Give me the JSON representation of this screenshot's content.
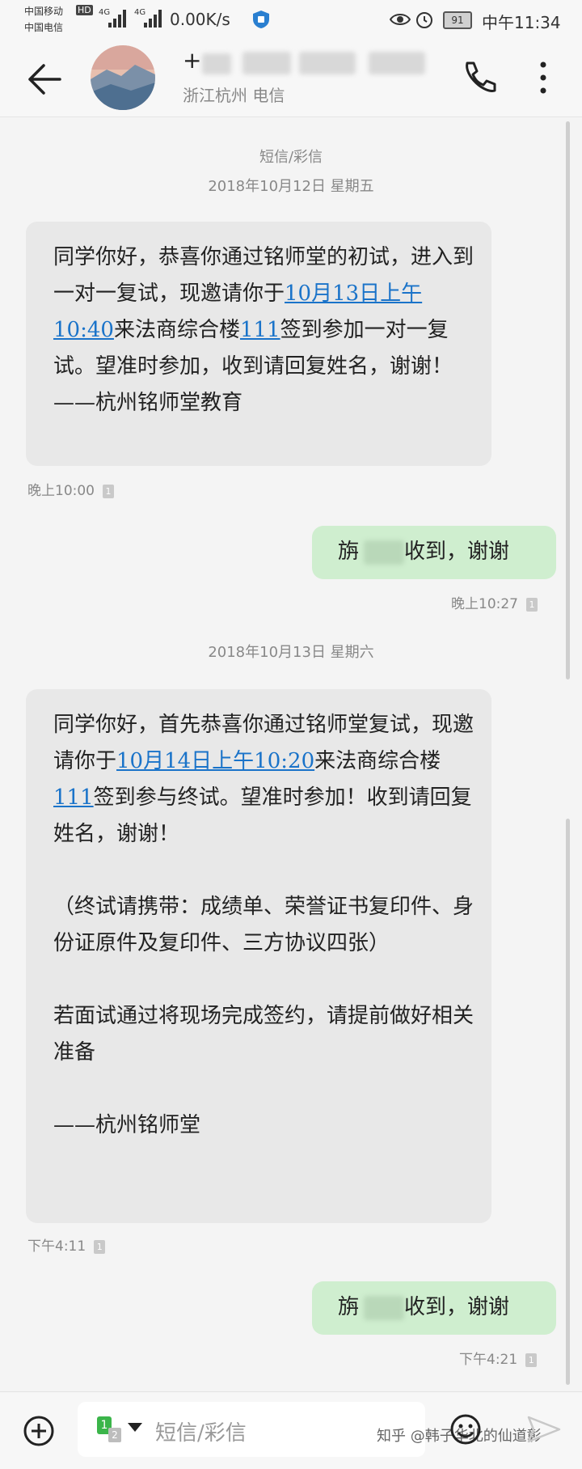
{
  "status_bar": {
    "carrier1": "中国移动",
    "hd": "HD",
    "net1": "4G",
    "net2": "4G",
    "speed": "0.00K/s",
    "battery": "91",
    "time": "中午11:34",
    "carrier2": "中国电信"
  },
  "header": {
    "name_prefix": "+",
    "location": "浙江杭州 电信"
  },
  "chat": {
    "category": "短信/彩信",
    "date1": "2018年10月12日 星期五",
    "msg1": {
      "p1": "同学你好，恭喜你通过铭师堂的初试，进入到一对一复试，现邀请你于",
      "link1": "10月13日上午10:40",
      "p2": "来法商综合楼",
      "link2": "111",
      "p3": "签到参加一对一复试。望准时参加，收到请回复姓名，谢谢！\n——杭州铭师堂教育",
      "time": "晚上10:00"
    },
    "reply1": {
      "prefix": "旃",
      "suffix": "收到，谢谢",
      "time": "晚上10:27"
    },
    "date2": "2018年10月13日 星期六",
    "msg2": {
      "p1": "同学你好，首先恭喜你通过铭师堂复试，现邀请你于",
      "link1": "10月14日上午10:20",
      "p2": "来法商综合楼",
      "link2": "111",
      "p3": "签到参与终试。望准时参加！收到请回复姓名，谢谢！\n\n（终试请携带：成绩单、荣誉证书复印件、身份证原件及复印件、三方协议四张）\n\n若面试通过将现场完成签约，请提前做好相关准备\n\n——杭州铭师堂",
      "time": "下午4:11"
    },
    "reply2": {
      "prefix": "旃",
      "suffix": "收到，谢谢",
      "time": "下午4:21"
    },
    "sim_badge": "1"
  },
  "composer": {
    "sim1": "1",
    "sim2": "2",
    "placeholder": "短信/彩信",
    "watermark": "知乎 @韩子华北的仙道彰"
  },
  "colors": {
    "accent": "#1a73c9",
    "outgoing": "#cfeecf",
    "incoming": "#e8e8e8"
  }
}
